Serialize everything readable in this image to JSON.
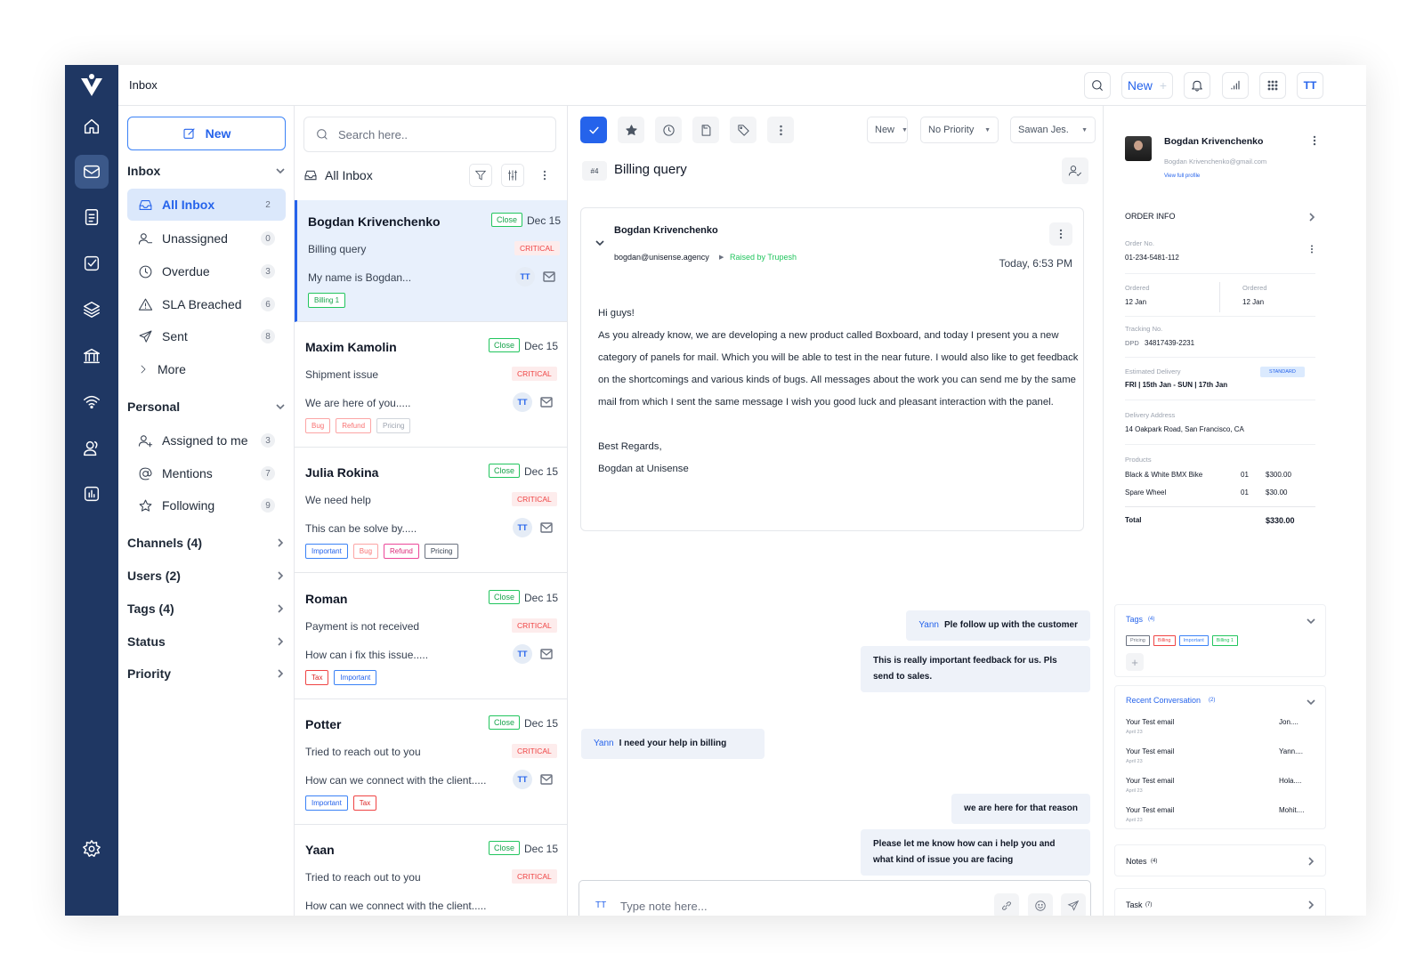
{
  "topbar": {
    "title": "Inbox",
    "new_label": "New",
    "user_initials": "TT"
  },
  "nav": {
    "new_label": "New",
    "inbox_heading": "Inbox",
    "inbox_items": [
      {
        "label": "All Inbox",
        "count": "2"
      },
      {
        "label": "Unassigned",
        "count": "0"
      },
      {
        "label": "Overdue",
        "count": "3"
      },
      {
        "label": "SLA Breached",
        "count": "6"
      },
      {
        "label": "Sent",
        "count": "8"
      },
      {
        "label": "More"
      }
    ],
    "personal_heading": "Personal",
    "personal_items": [
      {
        "label": "Assigned to me",
        "count": "3"
      },
      {
        "label": "Mentions",
        "count": "7"
      },
      {
        "label": "Following",
        "count": "9"
      }
    ],
    "groups": [
      "Channels (4)",
      "Users (2)",
      "Tags (4)",
      "Status",
      "Priority"
    ]
  },
  "list": {
    "search_placeholder": "Search here..",
    "heading": "All Inbox",
    "conversations": [
      {
        "name": "Bogdan Krivenchenko",
        "status": "Close",
        "date": "Dec 15",
        "subject": "Billing query",
        "priority": "CRITICAL",
        "preview": "My name is Bogdan...",
        "assignee": "TT",
        "tags": [
          {
            "label": "Billing 1",
            "color": "green"
          }
        ]
      },
      {
        "name": "Maxim Kamolin",
        "status": "Close",
        "date": "Dec 15",
        "subject": "Shipment issue",
        "priority": "CRITICAL",
        "preview": "We are here of you.....",
        "assignee": "TT",
        "tags": [
          {
            "label": "Bug",
            "color": "lred"
          },
          {
            "label": "Refund",
            "color": "lred"
          },
          {
            "label": "Pricing",
            "color": "gray"
          }
        ]
      },
      {
        "name": "Julia Rokina",
        "status": "Close",
        "date": "Dec 15",
        "subject": "We need help",
        "priority": "CRITICAL",
        "preview": "This can be solve by.....",
        "assignee": "TT",
        "tags": [
          {
            "label": "Important",
            "color": "blue"
          },
          {
            "label": "Bug",
            "color": "lred"
          },
          {
            "label": "Refund",
            "color": "pink"
          },
          {
            "label": "Pricing",
            "color": "dark"
          }
        ]
      },
      {
        "name": "Roman",
        "status": "Close",
        "date": "Dec 15",
        "subject": "Payment is not received",
        "priority": "CRITICAL",
        "preview": "How can i fix this issue.....",
        "assignee": "TT",
        "tags": [
          {
            "label": "Tax",
            "color": "red"
          },
          {
            "label": "Important",
            "color": "blue"
          }
        ]
      },
      {
        "name": "Potter",
        "status": "Close",
        "date": "Dec 15",
        "subject": "Tried to reach out to you",
        "priority": "CRITICAL",
        "preview": "How can we connect with the client.....",
        "assignee": "TT",
        "tags": [
          {
            "label": "Important",
            "color": "blue"
          },
          {
            "label": "Tax",
            "color": "red"
          }
        ]
      },
      {
        "name": "Yaan",
        "status": "Close",
        "date": "Dec 15",
        "subject": "Tried to reach out to you",
        "priority": "CRITICAL",
        "preview": "How can we connect with the client.....",
        "assignee": "",
        "tags": []
      }
    ]
  },
  "ticket": {
    "status_select": "New",
    "priority_select": "No Priority",
    "assignee_select": "Sawan Jes.",
    "number": "#4",
    "title": "Billing query",
    "email": {
      "from": "Bogdan Krivenchenko",
      "address": "bogdan@unisense.agency",
      "raised_by": "Raised by Trupesh",
      "time": "Today, 6:53 PM",
      "greeting": "Hi guys!",
      "paragraph": "As you already know, we are developing a new product called Boxboard, and today I present you a new category of panels for mail. Which you will be able to test in the near future. I would also like to get feedback on the shortcomings and various kinds of bugs. All messages about the work you can send me by the same mail from which I sent the same message I wish you good luck and pleasant interaction with the panel.",
      "signoff": "Best Regards,",
      "signature": "Bogdan at Unisense"
    },
    "notes": [
      {
        "who": "Yann",
        "text": "Ple follow up with the customer"
      },
      {
        "who": "",
        "text": "This is really important feedback for us. Pls send to sales."
      },
      {
        "who": "Yann",
        "text": "I need your help in billing"
      },
      {
        "who": "",
        "text": "we are here for that reason"
      },
      {
        "who": "",
        "text": "Please let me know how can i help you and what kind of issue you are facing"
      }
    ],
    "composer": {
      "initials": "TT",
      "placeholder": "Type note here..."
    }
  },
  "profile": {
    "name": "Bogdan Krivenchenko",
    "email": "Bogdan Krivenchenko@gmail.com",
    "view_link": "View full profile",
    "order_heading": "ORDER INFO",
    "order_no_label": "Order No.",
    "order_no": "01-234-5481-112",
    "ordered_label_1": "Ordered",
    "ordered_val_1": "12 Jan",
    "ordered_label_2": "Ordered",
    "ordered_val_2": "12 Jan",
    "tracking_label": "Tracking No.",
    "tracking_carrier": "DPD",
    "tracking_no": "34817439-2231",
    "delivery_est_label": "Estimated Delivery",
    "delivery_badge": "STANDARD",
    "delivery_est": "FRI  |  15th Jan - SUN  |  17th Jan",
    "address_label": "Delivery Address",
    "address": "14 Oakpark Road, San Francisco, CA",
    "products_label": "Products",
    "products": [
      {
        "name": "Black & White BMX Bike",
        "qty": "01",
        "price": "$300.00"
      },
      {
        "name": "Spare Wheel",
        "qty": "01",
        "price": "$30.00"
      }
    ],
    "total_label": "Total",
    "total": "$330.00",
    "tags_heading": "Tags",
    "tags_count": "(4)",
    "tags": [
      {
        "label": "Pricing",
        "color": "#6b7280"
      },
      {
        "label": "Billing",
        "color": "#ef4444"
      },
      {
        "label": "Important",
        "color": "#3b82f6"
      },
      {
        "label": "Billing 1",
        "color": "#22c55e"
      }
    ],
    "recent_heading": "Recent Conversation",
    "recent_count": "(2)",
    "recent": [
      {
        "subject": "Your Test email",
        "date": "April 23",
        "name": "Jon...."
      },
      {
        "subject": "Your Test email",
        "date": "April 23",
        "name": "Yann...."
      },
      {
        "subject": "Your Test email",
        "date": "April 23",
        "name": "Hola...."
      },
      {
        "subject": "Your Test email",
        "date": "April 23",
        "name": "Mohit...."
      }
    ],
    "notes_heading": "Notes",
    "notes_count": "(4)",
    "task_heading": "Task",
    "task_count": "(7)"
  },
  "colors": {
    "rail": "#1f3763",
    "accent": "#2563eb",
    "critical": "#ef4444",
    "close": "#22c55e"
  }
}
